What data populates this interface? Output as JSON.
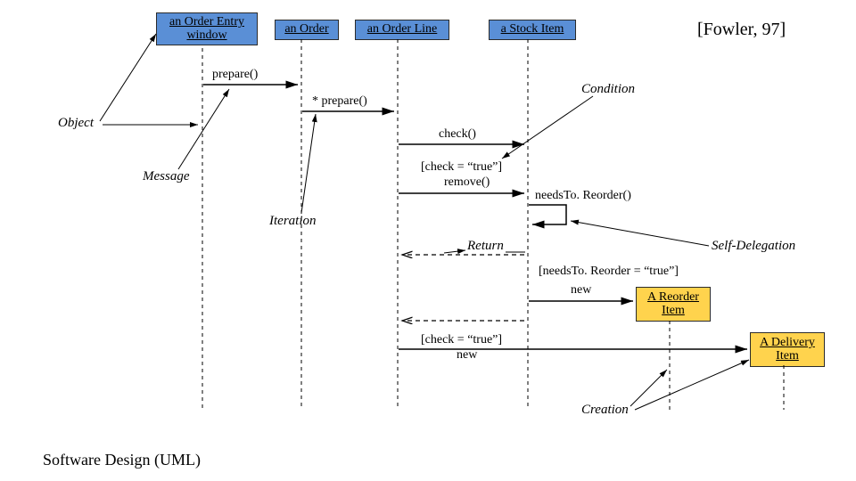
{
  "citation": "[Fowler, 97]",
  "footer": "Software Design (UML)",
  "participants": {
    "p1": "an Order Entry window",
    "p2": "an Order",
    "p3": "an Order Line",
    "p4": "a Stock Item",
    "p5": "A Reorder Item",
    "p6": "A Delivery Item"
  },
  "messages": {
    "m1": "prepare()",
    "m2": "* prepare()",
    "m3": "check()",
    "m4a": "[check = “true”]",
    "m4b": "remove()",
    "m5": "needsTo. Reorder()",
    "m6": "[needsTo. Reorder = “true”]",
    "m7": "new",
    "m8a": "[check = “true”]",
    "m8b": "new"
  },
  "annotations": {
    "object": "Object",
    "message": "Message",
    "iteration": "Iteration",
    "condition": "Condition",
    "return": "Return",
    "selfdel": "Self-Delegation",
    "creation": "Creation"
  }
}
